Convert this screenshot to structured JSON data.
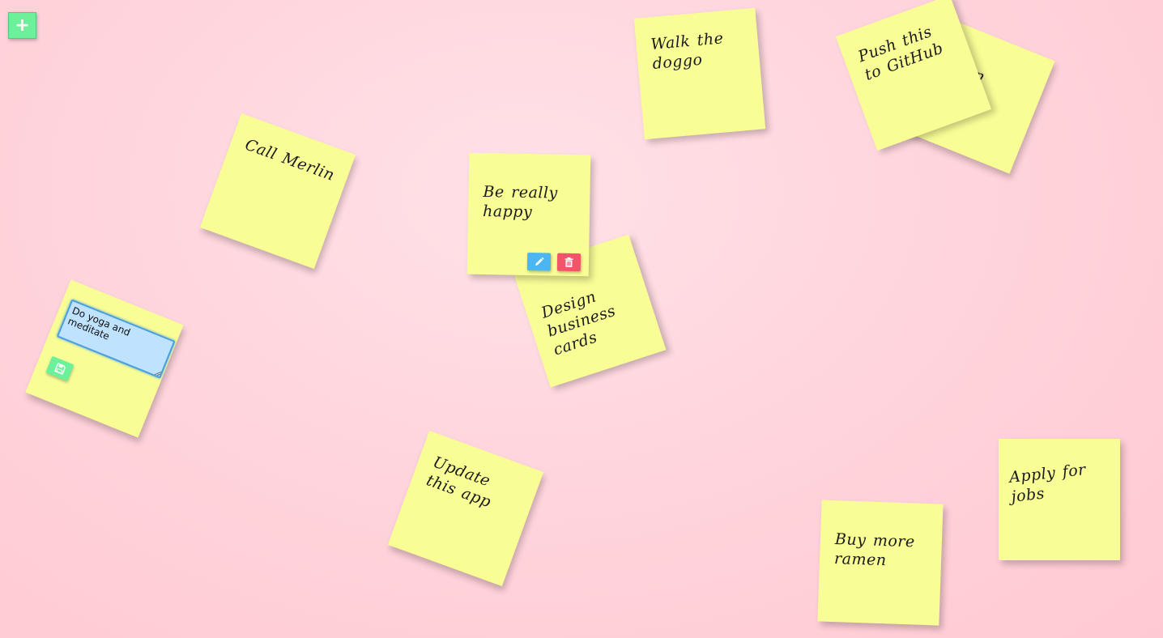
{
  "toolbar": {
    "add_label": "+"
  },
  "colors": {
    "note": "#f8fd96",
    "add": "#6cf09a",
    "edit": "#4bb6f2",
    "delete": "#f2546a",
    "save": "#6cf09a"
  },
  "notes": [
    {
      "text": "Call Merlin"
    },
    {
      "text": "Walk the doggo"
    },
    {
      "text": "Learn React"
    },
    {
      "text": "Push this to GitHub"
    },
    {
      "text": "Design business cards"
    },
    {
      "text": "Be really happy"
    },
    {
      "text": "Update this app"
    },
    {
      "text": "Buy more ramen"
    },
    {
      "text": "Apply for jobs"
    }
  ],
  "editing_note": {
    "value": "Do yoga and meditate"
  },
  "icons": {
    "edit": "pencil-icon",
    "delete": "trash-icon",
    "save": "floppy-disk-icon"
  }
}
